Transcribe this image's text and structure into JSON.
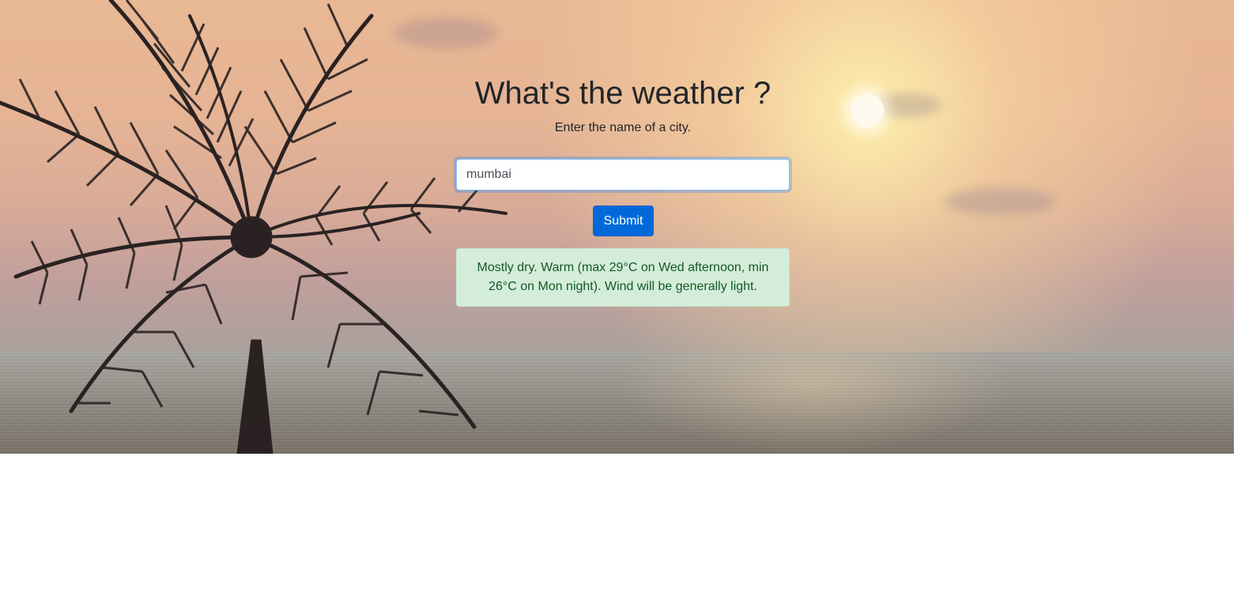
{
  "page": {
    "title": "What's the weather ?",
    "subtitle": "Enter the name of a city."
  },
  "form": {
    "city_value": "mumbai",
    "submit_label": "Submit"
  },
  "result": {
    "forecast": "Mostly dry. Warm (max 29°C on Wed afternoon, min 26°C on Mon night). Wind will be generally light."
  },
  "colors": {
    "button": "#0069d9",
    "alert_bg": "#d4edda",
    "alert_text": "#155724",
    "title": "#212529"
  },
  "background": {
    "image_icon": "palm-sunset-background"
  }
}
